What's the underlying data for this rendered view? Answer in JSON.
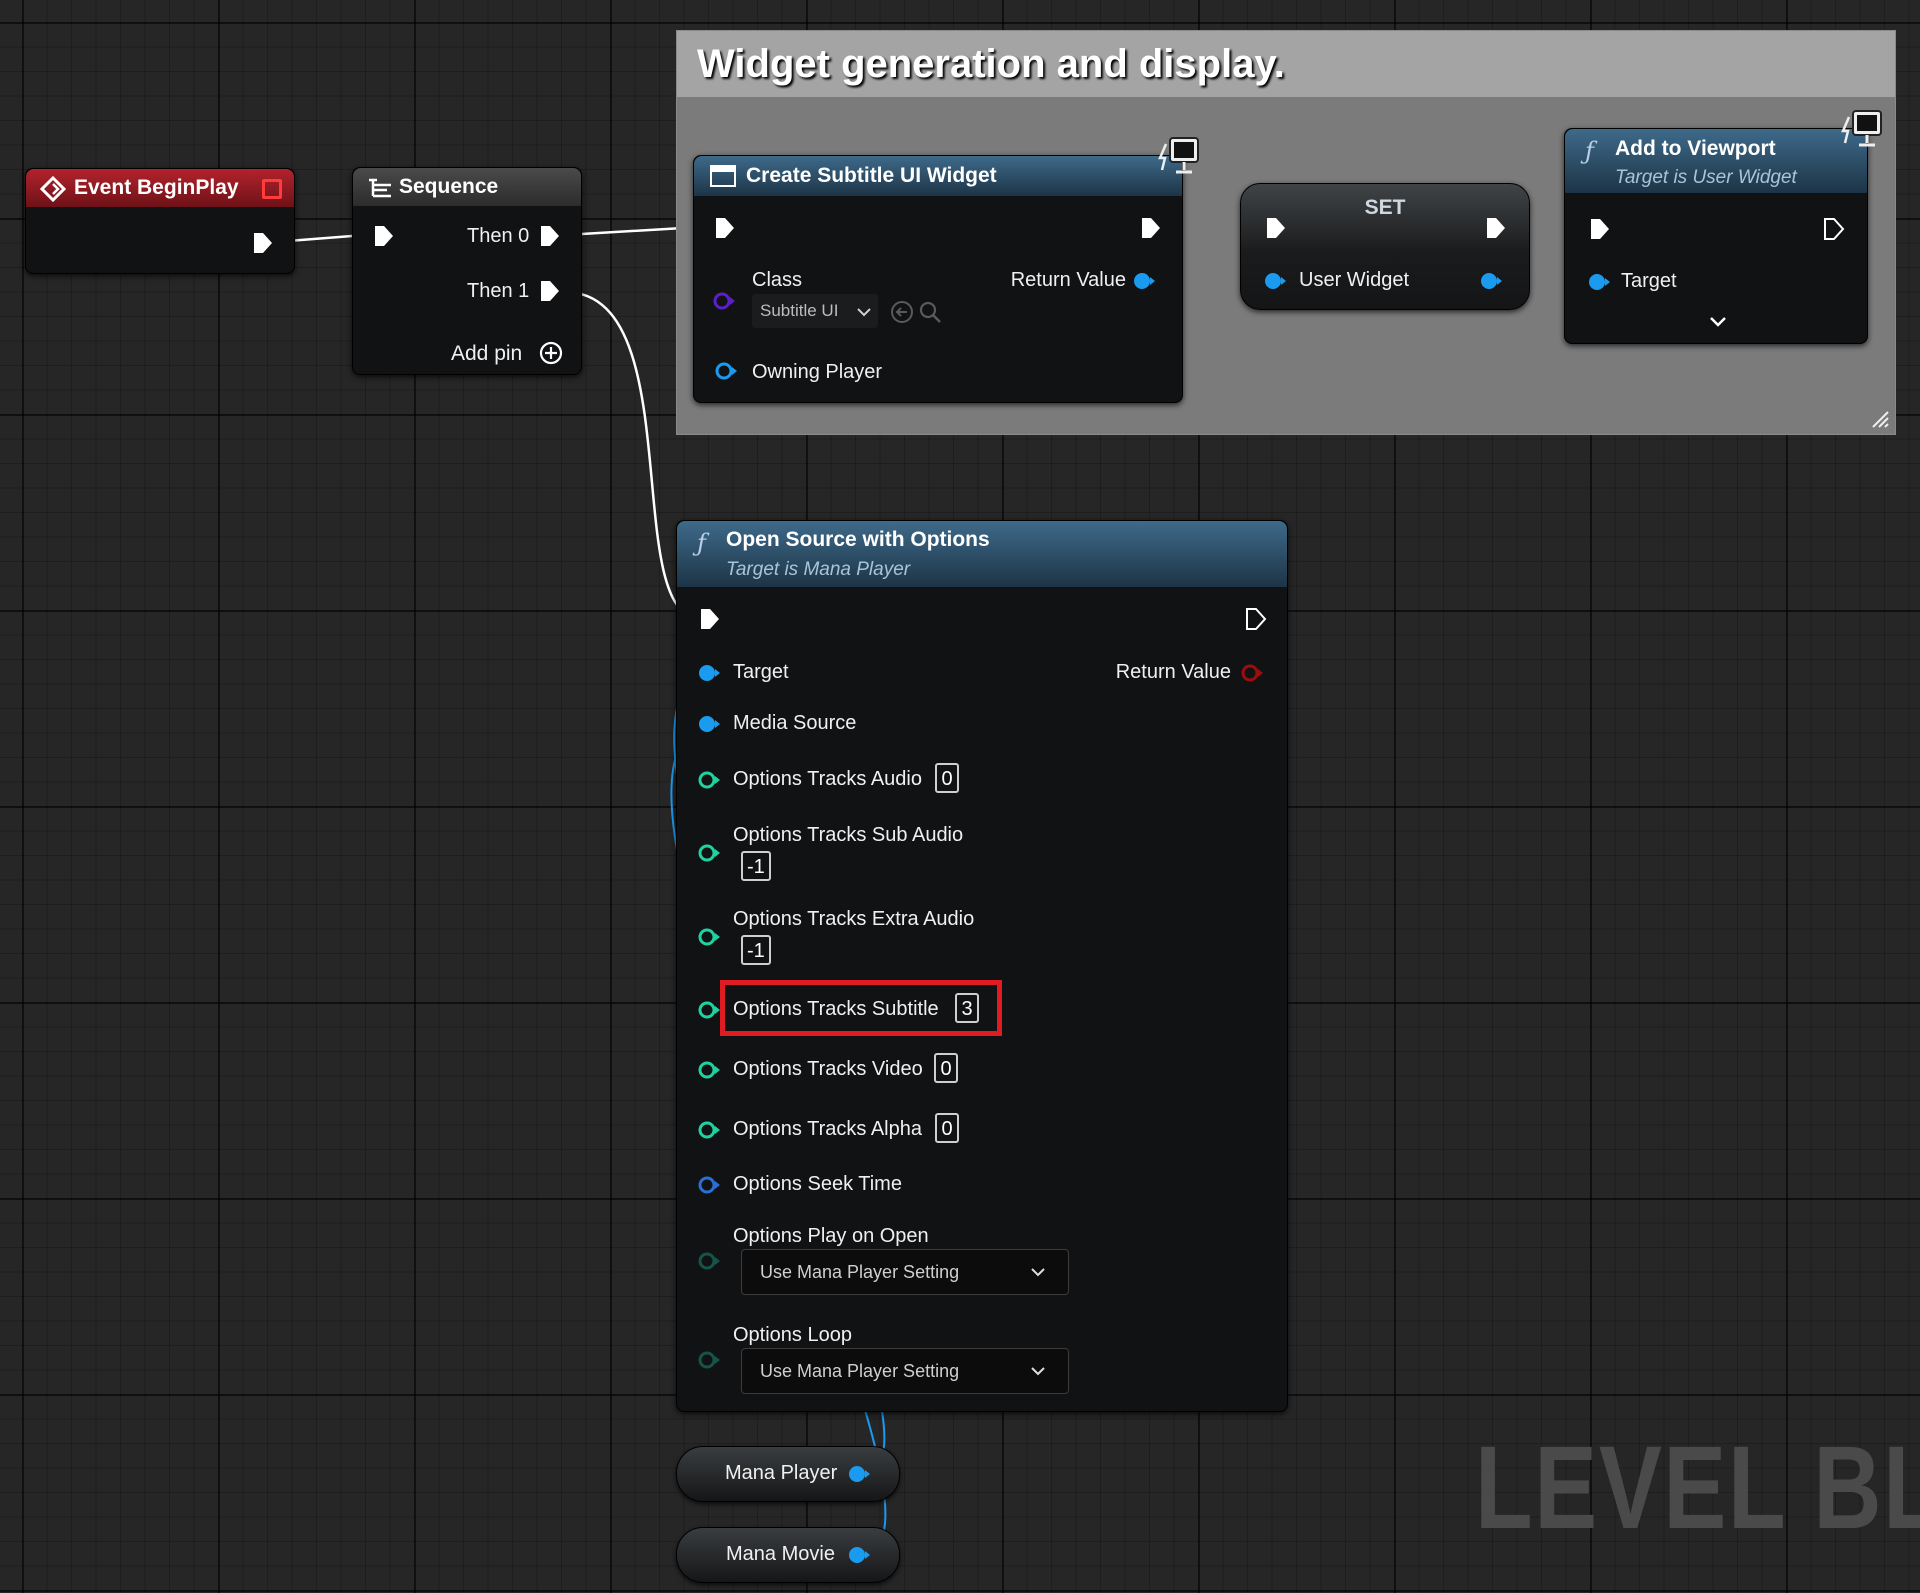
{
  "comment": {
    "title": "Widget generation and display."
  },
  "event_begin_play": {
    "title": "Event BeginPlay",
    "icon": "event-diamond-icon"
  },
  "sequence": {
    "title": "Sequence",
    "then0": "Then 0",
    "then1": "Then 1",
    "add_pin": "Add pin"
  },
  "create_widget": {
    "title": "Create Subtitle UI Widget",
    "class_label": "Class",
    "class_value": "Subtitle UI",
    "return_value": "Return Value",
    "owning_player": "Owning Player"
  },
  "set_node": {
    "title": "SET",
    "user_widget": "User Widget"
  },
  "add_to_viewport": {
    "title": "Add to Viewport",
    "subtitle": "Target is User Widget",
    "target": "Target"
  },
  "open_source": {
    "title": "Open Source with Options",
    "subtitle": "Target is Mana Player",
    "target": "Target",
    "return_value": "Return Value",
    "media_source": "Media Source",
    "tracks_audio": {
      "label": "Options Tracks Audio",
      "value": "0"
    },
    "tracks_sub_audio": {
      "label": "Options Tracks Sub Audio",
      "value": "-1"
    },
    "tracks_extra_audio": {
      "label": "Options Tracks Extra Audio",
      "value": "-1"
    },
    "tracks_subtitle": {
      "label": "Options Tracks Subtitle",
      "value": "3"
    },
    "tracks_video": {
      "label": "Options Tracks Video",
      "value": "0"
    },
    "tracks_alpha": {
      "label": "Options Tracks Alpha",
      "value": "0"
    },
    "seek_time": "Options Seek Time",
    "play_on_open": {
      "label": "Options Play on Open",
      "value": "Use Mana Player Setting"
    },
    "loop": {
      "label": "Options Loop",
      "value": "Use Mana Player Setting"
    }
  },
  "variables": {
    "mana_player": "Mana Player",
    "mana_movie": "Mana Movie"
  },
  "watermark": "LEVEL BL",
  "colors": {
    "exec": "#ffffff",
    "object_pin": "#1a9bf0",
    "int_pin": "#1fd3a0",
    "class_pin": "#5b1fc7",
    "bool_return": "#9b0e0e",
    "highlight": "#e11b22",
    "comment_bg": "#7b7b7b"
  }
}
